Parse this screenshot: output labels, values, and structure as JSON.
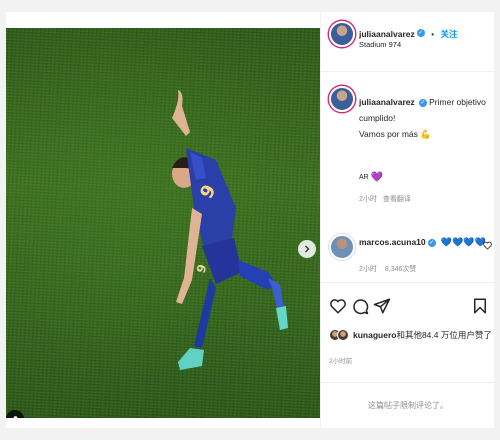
{
  "post": {
    "author": {
      "username": "juliaanalvarez",
      "verified": true,
      "follow_label": "关注",
      "separator": "•",
      "location": "Stadium 974"
    },
    "caption": {
      "line1": "Primer objetivo",
      "line2": "cumplido!",
      "line3": "Vamos por más",
      "emoji": "💪"
    },
    "caption_extra": {
      "flag_text": "AR",
      "heart": "💜"
    },
    "caption_meta": {
      "time": "2小时",
      "translate_label": "查看翻译"
    },
    "comment": {
      "username": "marcos.acuna10",
      "text": "💙💙💙💙",
      "time": "2小时",
      "likes": "8,346次赞"
    },
    "likes": {
      "user": "kunaguero",
      "text": "和其他84.4 万位用户赞了"
    },
    "post_time": "2小时前",
    "comments_closed": "这篇帖子限制评论了。"
  },
  "media": {
    "carousel_dots": 3,
    "active_dot": 0
  },
  "colors": {
    "accent": "#0095f6",
    "verified": "#3897f0",
    "comment_hearts": "#1d7fe0",
    "muted_text": "#8e8e8e"
  },
  "icons": [
    "heart-icon",
    "comment-icon",
    "share-icon",
    "bookmark-icon",
    "chevron-right-icon",
    "user-tag-icon",
    "like-comment-icon"
  ]
}
